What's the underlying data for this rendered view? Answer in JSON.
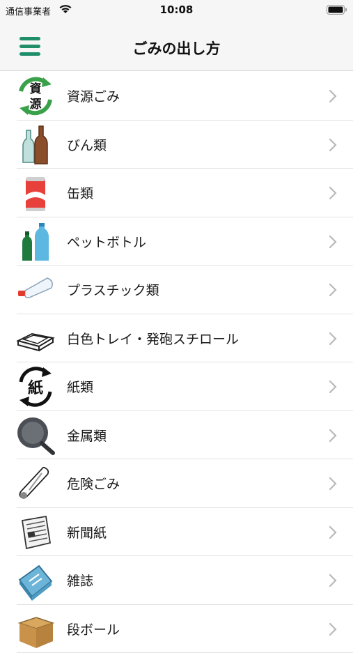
{
  "status_bar": {
    "carrier": "通信事業者",
    "time": "10:08"
  },
  "nav": {
    "title": "ごみの出し方"
  },
  "items": [
    {
      "label": "資源ごみ",
      "icon": "recycle-resource-icon"
    },
    {
      "label": "びん類",
      "icon": "bottles-icon"
    },
    {
      "label": "缶類",
      "icon": "can-icon"
    },
    {
      "label": "ペットボトル",
      "icon": "pet-bottle-icon"
    },
    {
      "label": "プラスチック類",
      "icon": "plastic-bag-icon"
    },
    {
      "label": "白色トレイ・発砲スチロール",
      "icon": "foam-tray-icon"
    },
    {
      "label": "紙類",
      "icon": "paper-recycle-icon"
    },
    {
      "label": "金属類",
      "icon": "frying-pan-icon"
    },
    {
      "label": "危険ごみ",
      "icon": "thermometer-icon"
    },
    {
      "label": "新聞紙",
      "icon": "newspaper-icon"
    },
    {
      "label": "雑誌",
      "icon": "magazine-icon"
    },
    {
      "label": "段ボール",
      "icon": "cardboard-box-icon"
    }
  ],
  "colors": {
    "accent": "#1f8e6a",
    "chevron": "#b9b9b9"
  }
}
